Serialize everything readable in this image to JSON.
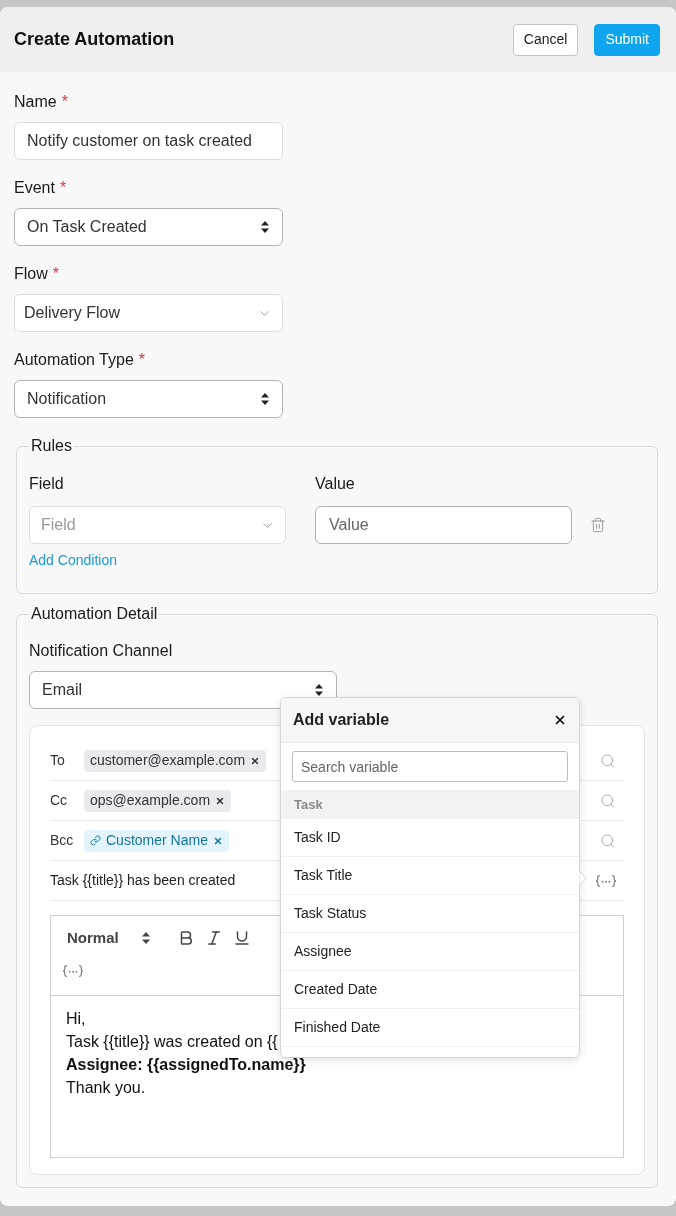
{
  "dialog": {
    "title": "Create Automation",
    "actions": [
      {
        "label": "Cancel",
        "kind": "secondary"
      },
      {
        "label": "Submit",
        "kind": "primary"
      }
    ]
  },
  "fields": [
    {
      "label": "Name",
      "required_mark": "*",
      "kind": "text",
      "value": "Notify customer on task created"
    },
    {
      "label": "Event",
      "required_mark": "*",
      "kind": "select",
      "value": "On Task Created"
    },
    {
      "label": "Flow",
      "required_mark": "*",
      "kind": "dropdown",
      "value": "Delivery Flow"
    },
    {
      "label": "Automation Type",
      "required_mark": "*",
      "kind": "select",
      "value": "Notification"
    }
  ],
  "rules": {
    "legend": "Rules",
    "columns": [
      "Field",
      "Value"
    ],
    "conditions": [
      {
        "field": {
          "placeholder": "Field"
        },
        "value": {
          "placeholder": "Value"
        }
      }
    ],
    "add_link": "Add Condition"
  },
  "automation_detail": {
    "legend": "Automation Detail",
    "channel": {
      "label": "Notification Channel",
      "kind": "select",
      "value": "Email"
    },
    "recipients": [
      {
        "label": "To",
        "tags": [
          {
            "text": "customer@example.com",
            "kind": "address"
          }
        ]
      },
      {
        "label": "Cc",
        "tags": [
          {
            "text": "ops@example.com",
            "kind": "address"
          }
        ]
      },
      {
        "label": "Bcc",
        "tags": [
          {
            "text": "Customer Name",
            "kind": "variable"
          }
        ]
      }
    ],
    "subject": "Task {{title}} has been created",
    "editor": {
      "format": "Normal",
      "lines": [
        {
          "text": "Hi,",
          "bold": false
        },
        {
          "text": "Task {{title}} was created on {{",
          "bold": false
        },
        {
          "text": "Assignee: {{assignedTo.name}}",
          "bold": true
        },
        {
          "text": "Thank you.",
          "bold": false
        }
      ]
    }
  },
  "variable_popover": {
    "title": "Add variable",
    "search": {
      "placeholder": "Search variable"
    },
    "groups": [
      {
        "label": "Task",
        "items": [
          "Task ID",
          "Task Title",
          "Task Status",
          "Assignee",
          "Created Date",
          "Finished Date"
        ]
      }
    ]
  }
}
